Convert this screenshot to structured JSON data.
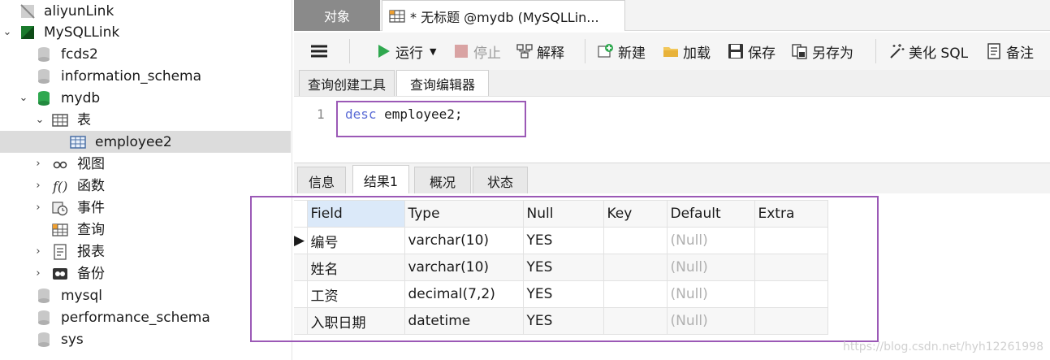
{
  "sidebar": {
    "items": [
      {
        "label": "aliyunLink",
        "icon": "connection-icon"
      },
      {
        "label": "MySQLLink",
        "icon": "mysql-connection-icon"
      },
      {
        "label": "fcds2",
        "icon": "database-icon"
      },
      {
        "label": "information_schema",
        "icon": "database-icon"
      },
      {
        "label": "mydb",
        "icon": "database-open-icon"
      },
      {
        "label": "表",
        "icon": "tables-icon"
      },
      {
        "label": "employee2",
        "icon": "table-icon"
      },
      {
        "label": "视图",
        "icon": "views-icon"
      },
      {
        "label": "函数",
        "icon": "function-icon"
      },
      {
        "label": "事件",
        "icon": "event-icon"
      },
      {
        "label": "查询",
        "icon": "query-icon"
      },
      {
        "label": "报表",
        "icon": "report-icon"
      },
      {
        "label": "备份",
        "icon": "backup-icon"
      },
      {
        "label": "mysql",
        "icon": "database-icon"
      },
      {
        "label": "performance_schema",
        "icon": "database-icon"
      },
      {
        "label": "sys",
        "icon": "database-icon"
      }
    ]
  },
  "tabs": {
    "objects": "对象",
    "query": "* 无标题 @mydb (MySQLLin..."
  },
  "toolbar": {
    "run": "运行",
    "stop": "停止",
    "explain": "解释",
    "new": "新建",
    "load": "加载",
    "save": "保存",
    "save_as": "另存为",
    "beautify": "美化 SQL",
    "note": "备注"
  },
  "subtabs": {
    "builder": "查询创建工具",
    "editor": "查询编辑器"
  },
  "editor": {
    "line_number": "1",
    "keyword": "desc",
    "rest": " employee2;"
  },
  "result_tabs": {
    "info": "信息",
    "result1": "结果1",
    "profile": "概况",
    "status": "状态"
  },
  "grid": {
    "columns": [
      "Field",
      "Type",
      "Null",
      "Key",
      "Default",
      "Extra"
    ],
    "rows": [
      [
        "编号",
        "varchar(10)",
        "YES",
        "",
        "(Null)",
        ""
      ],
      [
        "姓名",
        "varchar(10)",
        "YES",
        "",
        "(Null)",
        ""
      ],
      [
        "工资",
        "decimal(7,2)",
        "YES",
        "",
        "(Null)",
        ""
      ],
      [
        "入职日期",
        "datetime",
        "YES",
        "",
        "(Null)",
        ""
      ]
    ]
  },
  "watermark": "https://blog.csdn.net/hyh12261998",
  "colors": {
    "highlight_box": "#9b59b6",
    "run_green": "#2fa84f",
    "keyword_blue": "#5b6cd6"
  }
}
